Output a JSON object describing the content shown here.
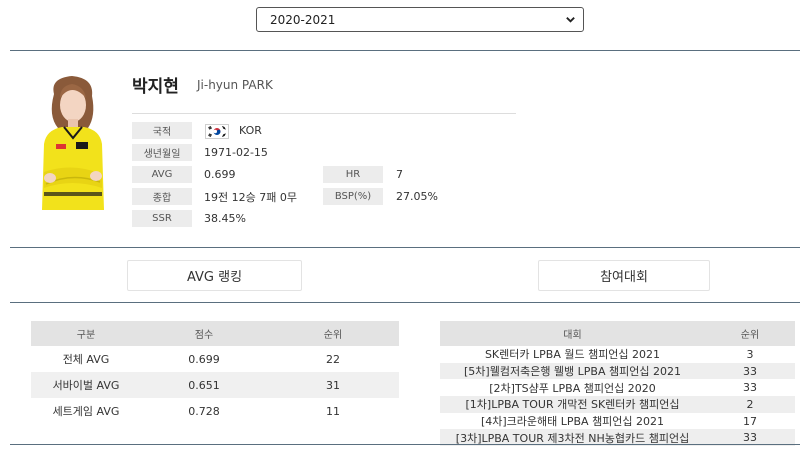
{
  "season_select": {
    "value": "2020-2021"
  },
  "player": {
    "name_ko": "박지현",
    "name_en": "Ji-hyun PARK",
    "info": {
      "nationality_label": "국적",
      "nationality": "KOR",
      "birth_label": "생년월일",
      "birth": "1971-02-15",
      "avg_label": "AVG",
      "avg": "0.699",
      "hr_label": "HR",
      "hr": "7",
      "record_label": "종합",
      "record": "19전 12승 7패 0무",
      "bsp_label": "BSP(%)",
      "bsp": "27.05%",
      "ssr_label": "SSR",
      "ssr": "38.45%"
    }
  },
  "buttons": {
    "avg_ranking": "AVG 랭킹",
    "tournaments": "참여대회"
  },
  "avg_table": {
    "headers": [
      "구분",
      "점수",
      "순위"
    ],
    "rows": [
      [
        "전체 AVG",
        "0.699",
        "22"
      ],
      [
        "서바이벌 AVG",
        "0.651",
        "31"
      ],
      [
        "세트게임 AVG",
        "0.728",
        "11"
      ]
    ]
  },
  "tour_table": {
    "headers": [
      "대회",
      "순위"
    ],
    "rows": [
      [
        "SK렌터카 LPBA 월드 챔피언십 2021",
        "3"
      ],
      [
        "[5차]웰컴저축은행 웰뱅 LPBA 챔피언십 2021",
        "33"
      ],
      [
        "[2차]TS샴푸 LPBA 챔피언십 2020",
        "33"
      ],
      [
        "[1차]LPBA TOUR 개막전 SK렌터카 챔피언십",
        "2"
      ],
      [
        "[4차]크라운해태 LPBA 챔피언십 2021",
        "17"
      ],
      [
        "[3차]LPBA TOUR 제3차전 NH농협카드 챔피언십",
        "33"
      ]
    ]
  },
  "icons": {
    "select": "chevron-down-icon",
    "flag": "korea-flag-icon",
    "photo": "player-photo"
  },
  "colors": {
    "label_bg": "#ececec",
    "table_header_bg": "#e3e3e3",
    "divider": "#5a6f7f",
    "jersey": "#f2e21b"
  }
}
